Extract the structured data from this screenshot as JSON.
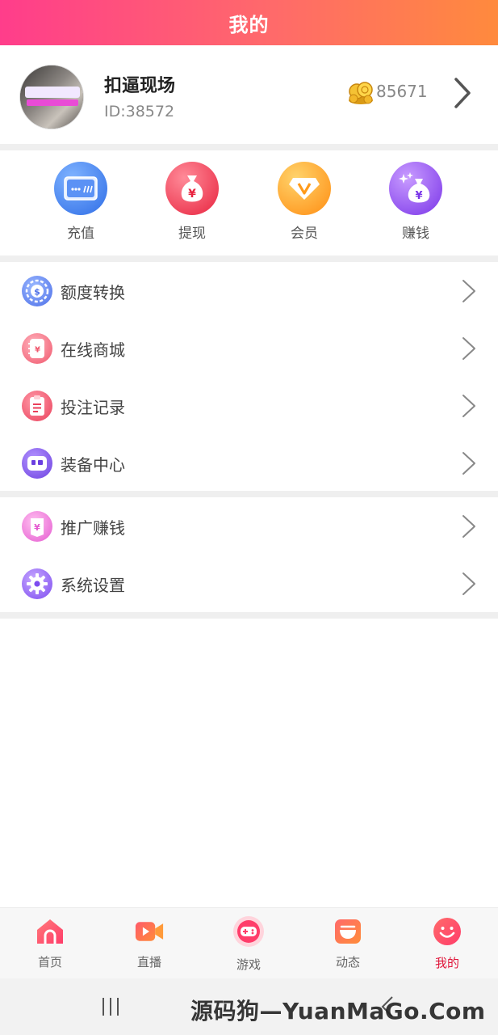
{
  "header": {
    "title": "我的"
  },
  "profile": {
    "name": "扣逼现场",
    "id_text": "ID:38572",
    "coins": "85671"
  },
  "quick_actions": [
    {
      "label": "充值",
      "icon": "card-icon",
      "color": "#3d7ff0"
    },
    {
      "label": "提现",
      "icon": "money-bag-yen-icon",
      "color": "#f0344e"
    },
    {
      "label": "会员",
      "icon": "vip-diamond-icon",
      "color": "#ffa11a"
    },
    {
      "label": "赚钱",
      "icon": "money-bag-sparkle-icon",
      "color": "#8a4cf0"
    }
  ],
  "menu_group_1": [
    {
      "label": "额度转换",
      "icon": "dollar-chip-icon"
    },
    {
      "label": "在线商城",
      "icon": "shop-yen-icon"
    },
    {
      "label": "投注记录",
      "icon": "clipboard-icon"
    },
    {
      "label": "装备中心",
      "icon": "equipment-icon"
    }
  ],
  "menu_group_2": [
    {
      "label": "推广赚钱",
      "icon": "promo-yen-icon"
    },
    {
      "label": "系统设置",
      "icon": "gear-icon"
    }
  ],
  "bottom_nav": [
    {
      "label": "首页",
      "icon": "home-icon",
      "active": false
    },
    {
      "label": "直播",
      "icon": "live-video-icon",
      "active": false
    },
    {
      "label": "游戏",
      "icon": "gamepad-icon",
      "active": false
    },
    {
      "label": "动态",
      "icon": "feed-icon",
      "active": false
    },
    {
      "label": "我的",
      "icon": "smile-icon",
      "active": true
    }
  ],
  "watermark": "源码狗—YuanMaGo.Com",
  "colors": {
    "header_gradient_start": "#ff3d8b",
    "header_gradient_end": "#ff8a3d",
    "active_nav": "#e0173b"
  }
}
